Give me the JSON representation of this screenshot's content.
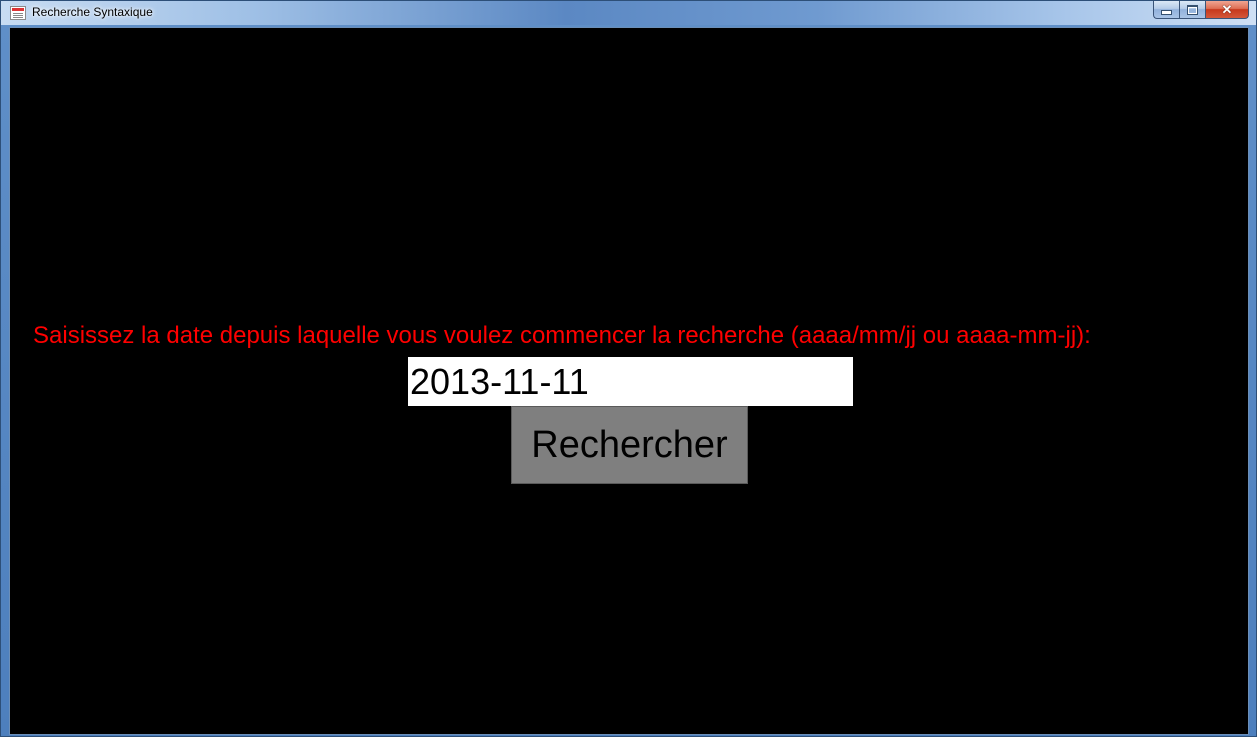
{
  "window": {
    "title": "Recherche Syntaxique",
    "icon": "app-document-icon",
    "controls": {
      "minimize": "minimize-icon",
      "maximize": "maximize-icon",
      "close": "close-icon"
    }
  },
  "form": {
    "prompt": "Saisissez la date depuis laquelle vous voulez commencer la recherche (aaaa/mm/jj ou aaaa-mm-jj):",
    "date_value": "2013-11-11",
    "search_label": "Rechercher"
  },
  "colors": {
    "background": "#000000",
    "prompt_text": "#ff0000",
    "input_background": "#ffffff",
    "button_background": "#7f7f7f"
  }
}
